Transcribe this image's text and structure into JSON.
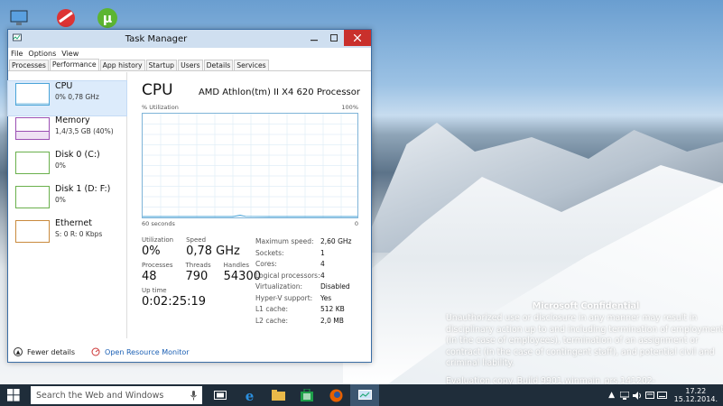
{
  "desktop": {
    "confidential_title": "Microsoft Confidential",
    "confidential_body": "Unauthorized use or disclosure in any manner may result in disciplinary action up to and including termination of employment (in the case of employees), termination of an assignment or contract (in the case of contingent staff), and potential civil and criminal liability.",
    "evaluation": "Evaluation copy. Build 9901.winmain_prs.141202-1718.c4f9af4aa7fe8544"
  },
  "taskbar": {
    "search_placeholder": "Search the Web and Windows",
    "time": "17.22",
    "date": "15.12.2014."
  },
  "window": {
    "title": "Task Manager",
    "menu": [
      "File",
      "Options",
      "View"
    ],
    "tabs": [
      "Processes",
      "Performance",
      "App history",
      "Startup",
      "Users",
      "Details",
      "Services"
    ],
    "active_tab": "Performance"
  },
  "sidebar": {
    "items": [
      {
        "title": "CPU",
        "sub": "0%  0,78 GHz",
        "color": "#4aa4d8"
      },
      {
        "title": "Memory",
        "sub": "1,4/3,5 GB (40%)",
        "color": "#9b4fb3"
      },
      {
        "title": "Disk 0 (C:)",
        "sub": "0%",
        "color": "#6ab04c"
      },
      {
        "title": "Disk 1 (D: F:)",
        "sub": "0%",
        "color": "#6ab04c"
      },
      {
        "title": "Ethernet",
        "sub_s": "S:",
        "sub_s_val": "0",
        "sub_r": "R:",
        "sub_r_val": "0 Kbps",
        "color": "#c98a3d"
      }
    ]
  },
  "main": {
    "heading": "CPU",
    "processor": "AMD Athlon(tm) II X4 620 Processor",
    "graph_label_left": "% Utilization",
    "graph_label_right": "100%",
    "graph_bottom_left": "60 seconds",
    "graph_bottom_right": "0",
    "utilization_label": "Utilization",
    "utilization": "0%",
    "speed_label": "Speed",
    "speed": "0,78 GHz",
    "processes_label": "Processes",
    "processes": "48",
    "threads_label": "Threads",
    "threads": "790",
    "handles_label": "Handles",
    "handles": "54300",
    "uptime_label": "Up time",
    "uptime": "0:02:25:19",
    "details": [
      {
        "k": "Maximum speed:",
        "v": "2,60 GHz"
      },
      {
        "k": "Sockets:",
        "v": "1"
      },
      {
        "k": "Cores:",
        "v": "4"
      },
      {
        "k": "Logical processors:",
        "v": "4"
      },
      {
        "k": "Virtualization:",
        "v": "Disabled"
      },
      {
        "k": "Hyper-V support:",
        "v": "Yes"
      },
      {
        "k": "L1 cache:",
        "v": "512 KB"
      },
      {
        "k": "L2 cache:",
        "v": "2,0 MB"
      }
    ]
  },
  "footer": {
    "fewer_details": "Fewer details",
    "resource_monitor": "Open Resource Monitor"
  },
  "colors": {
    "accent": "#4aa4d8",
    "titlebar": "#cfdff0",
    "close": "#c9302c",
    "taskbar": "#1f2d3a"
  }
}
